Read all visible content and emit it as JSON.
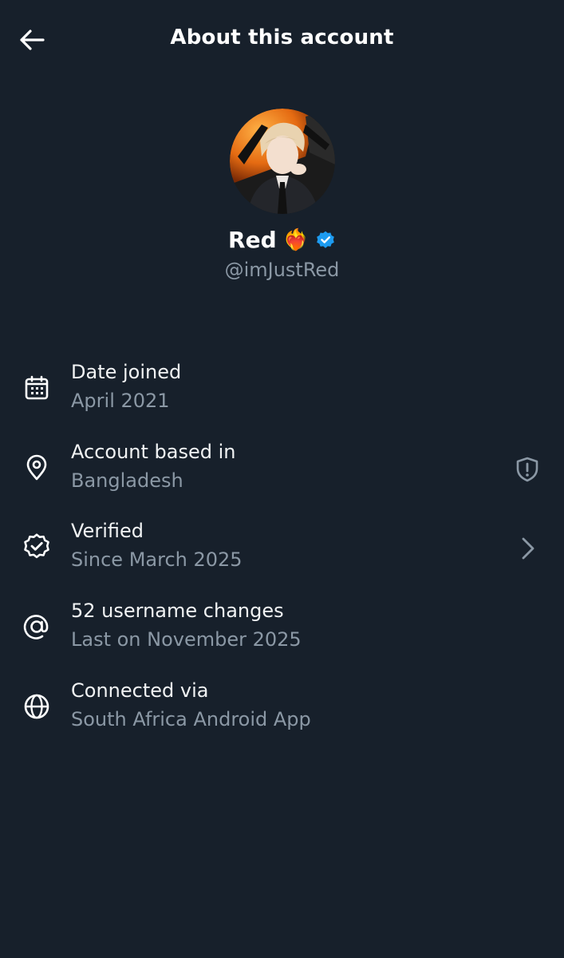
{
  "header": {
    "title": "About this account",
    "back_icon": "arrow-left-icon"
  },
  "profile": {
    "display_name": "Red",
    "name_emoji": "❤️‍🔥",
    "verified_icon": "verified-badge-icon",
    "handle": "@imJustRed",
    "avatar": "profile-avatar"
  },
  "info_rows": [
    {
      "icon": "calendar-icon",
      "title": "Date joined",
      "subtitle": "April 2021"
    },
    {
      "icon": "location-pin-icon",
      "title": "Account based in",
      "subtitle": "Bangladesh",
      "trailing_icon": "shield-alert-icon"
    },
    {
      "icon": "verified-check-icon",
      "title": "Verified",
      "subtitle": "Since March 2025",
      "trailing_icon": "chevron-right-icon"
    },
    {
      "icon": "at-sign-icon",
      "title": "52 username changes",
      "subtitle": "Last on November 2025"
    },
    {
      "icon": "globe-icon",
      "title": "Connected via",
      "subtitle": "South Africa Android App"
    }
  ],
  "colors": {
    "background": "#17202b",
    "primary_text": "#e7e9ea",
    "secondary_text": "#8b98a5",
    "verified_blue": "#1d9bf0"
  }
}
